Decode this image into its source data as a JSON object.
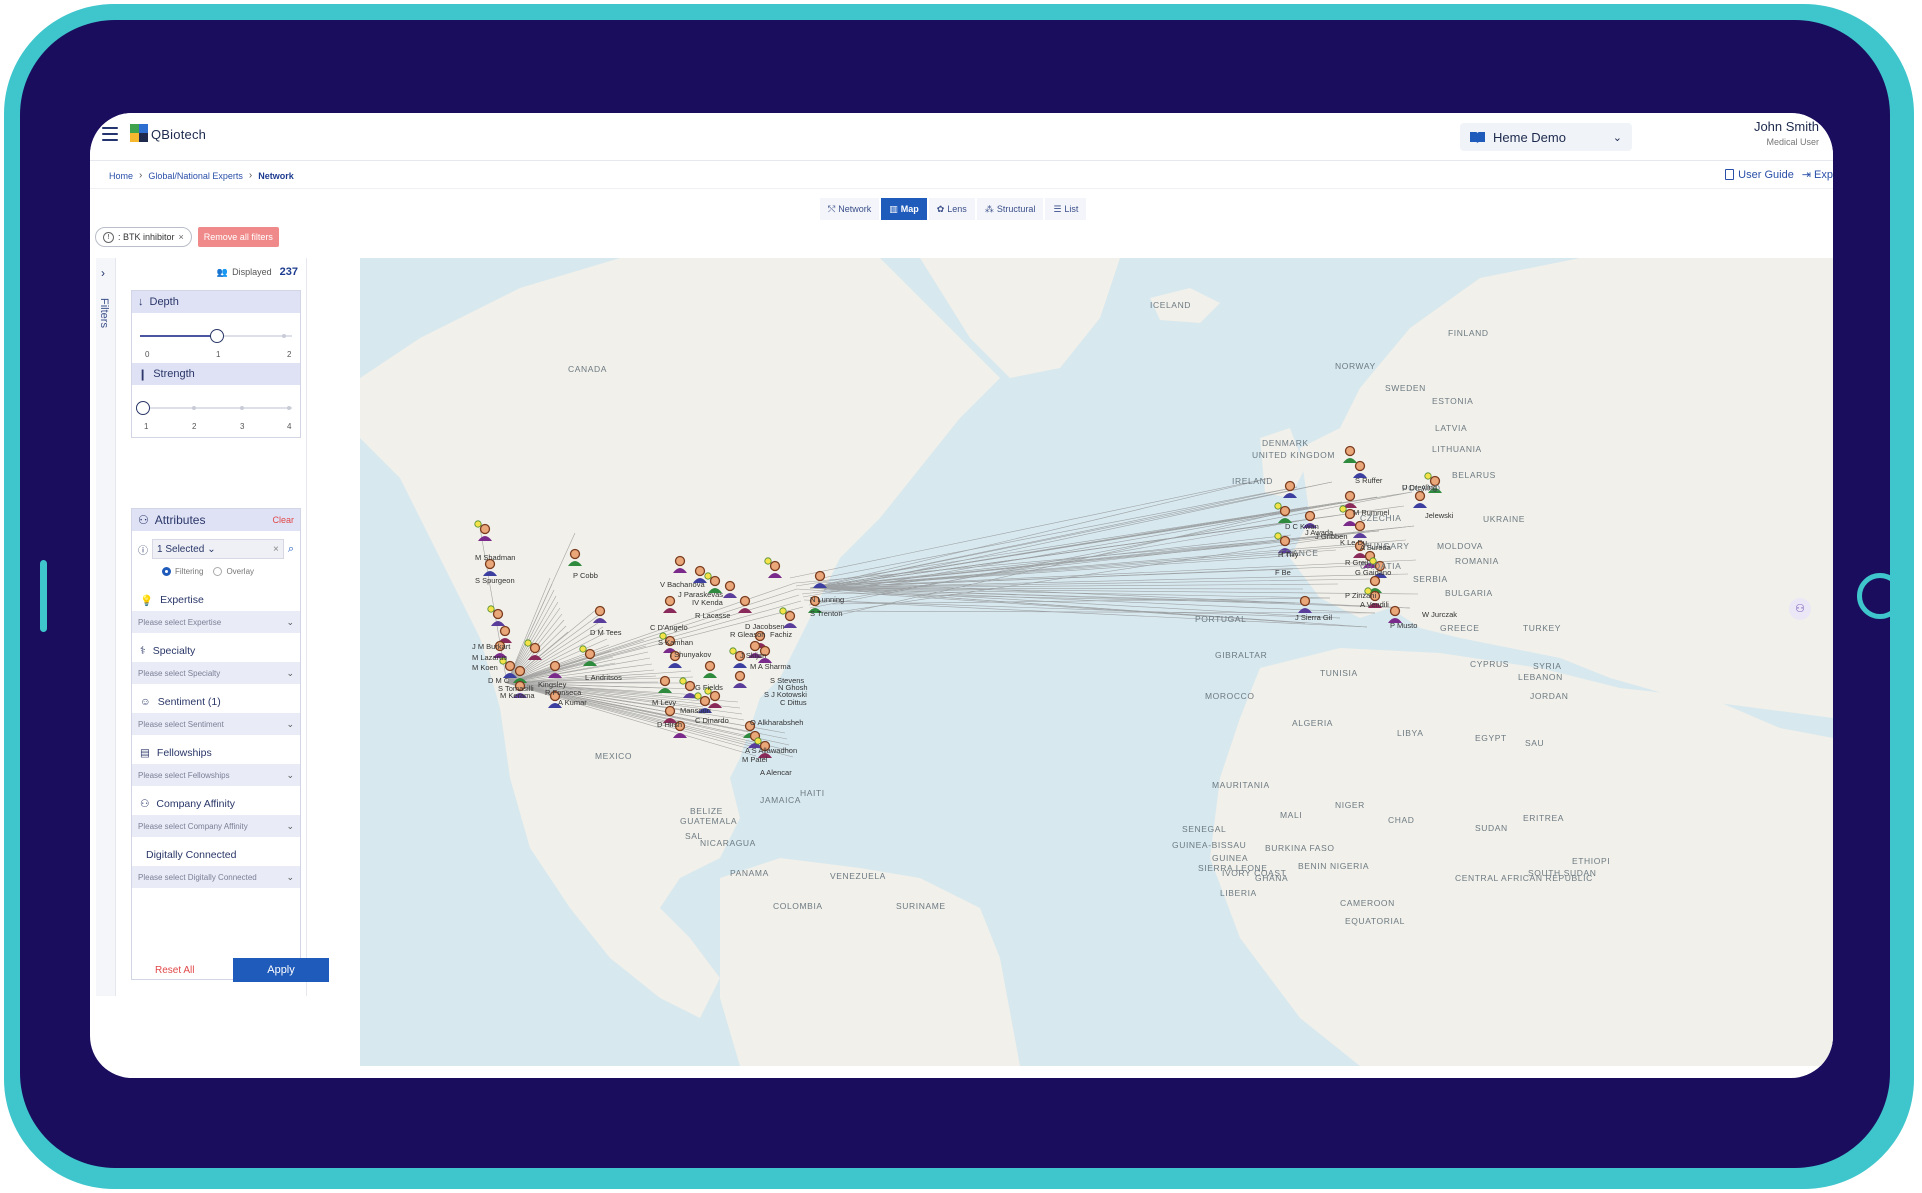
{
  "app": {
    "name": "QBiotech"
  },
  "project": {
    "label": "Heme Demo"
  },
  "user": {
    "name": "John Smith",
    "role": "Medical User"
  },
  "breadcrumb": {
    "items": [
      "Home",
      "Global/National Experts"
    ],
    "current": "Network"
  },
  "header_links": {
    "user_guide": "User Guide",
    "export": "Exp"
  },
  "view_tabs": [
    "Network",
    "Map",
    "Lens",
    "Structural",
    "List"
  ],
  "active_view": "Map",
  "active_filters": {
    "chip_label": ": BTK inhibitor",
    "remove_all": "Remove all filters"
  },
  "sidebar": {
    "tab_label": "Filters",
    "displayed_label": "Displayed",
    "displayed_count": "237",
    "depth": {
      "label": "Depth",
      "ticks": [
        "0",
        "1",
        "2"
      ],
      "value": 1
    },
    "strength": {
      "label": "Strength",
      "ticks": [
        "1",
        "2",
        "3",
        "4"
      ],
      "value": 1
    },
    "attributes": {
      "label": "Attributes",
      "clear": "Clear",
      "selected": "1 Selected",
      "mode_filtering": "Filtering",
      "mode_overlay": "Overlay",
      "items": [
        {
          "label": "Expertise",
          "placeholder": "Please select Expertise"
        },
        {
          "label": "Specialty",
          "placeholder": "Please select Specialty"
        },
        {
          "label": "Sentiment (1)",
          "placeholder": "Please select Sentiment"
        },
        {
          "label": "Fellowships",
          "placeholder": "Please select Fellowships"
        },
        {
          "label": "Company Affinity",
          "placeholder": "Please select Company Affinity"
        },
        {
          "label": "Digitally Connected",
          "placeholder": "Please select Digitally Connected"
        }
      ]
    },
    "reset_label": "Reset All",
    "apply_label": "Apply"
  },
  "map": {
    "places": [
      "ICELAND",
      "CANADA",
      "FINLAND",
      "NORWAY",
      "SWEDEN",
      "ESTONIA",
      "LATVIA",
      "DENMARK",
      "LITHUANIA",
      "UNITED KINGDOM",
      "IRELAND",
      "BELARUS",
      "POLAND",
      "CZECHIA",
      "UKRAINE",
      "FRANCE",
      "HUNGARY",
      "MOLDOVA",
      "ROMANIA",
      "CROATIA",
      "SERBIA",
      "BULGARIA",
      "PORTUGAL",
      "GREECE",
      "TURKEY",
      "GIBRALTAR",
      "TUNISIA",
      "CYPRUS",
      "SYRIA",
      "LEBANON",
      "MOROCCO",
      "JORDAN",
      "ALGERIA",
      "LIBYA",
      "EGYPT",
      "SAU",
      "MEXICO",
      "MAURITANIA",
      "MALI",
      "NIGER",
      "CHAD",
      "SUDAN",
      "ERITREA",
      "BELIZE",
      "JAMAICA",
      "HAITI",
      "GUATEMALA",
      "SAL",
      "NICARAGUA",
      "SENEGAL",
      "GUINEA-BISSAU",
      "GUINEA",
      "BURKINA FASO",
      "BENIN",
      "NIGERIA",
      "SIERRA LEONE",
      "IVORY COAST",
      "GHANA",
      "CENTRAL AFRICAN REPUBLIC",
      "SOUTH SUDAN",
      "ETHIOPI",
      "PANAMA",
      "VENEZUELA",
      "COLOMBIA",
      "SURINAME",
      "LIBERIA",
      "CAMEROON",
      "EQUATORIAL"
    ],
    "experts": [
      "M Shadman",
      "S Spurgeon",
      "P Cobb",
      "J M Burkart",
      "M Lazarus",
      "M Koen",
      "D M C",
      "S Tomasilli",
      "M Kerama",
      "Kingsley",
      "R Fonseca",
      "A Kumar",
      "L Andritsos",
      "D M Tees",
      "C D'Angelo",
      "S Kamhan",
      "I Shunyakov",
      "M Levy",
      "Mansouri",
      "D Hirsh",
      "C Dinardo",
      "O Alkharabsheh",
      "A S Allawadhon",
      "M Patel",
      "A Alencar",
      "V Bachanova",
      "J Paraskevas",
      "IV Kenda",
      "R Lacasse",
      "D Jacobsen",
      "N Lunning",
      "S Trenton",
      "Fachiz",
      "R Gleason",
      "J Skijan",
      "M A Sharma",
      "S Stevens",
      "N Ghosh",
      "S J Kotowski",
      "G Fields",
      "C Dittus",
      "H Tilly",
      "D C Kwan",
      "J Awada",
      "M Rummel",
      "J Gribben",
      "S Ruffer",
      "K Le Du",
      "F Be",
      "R Greil",
      "G Gaidano",
      "P Zinzani",
      "A Vendili",
      "J Sierra Gil",
      "P Musto",
      "W Jurczak",
      "Jelewski",
      "U Dreyling",
      "A Sureda"
    ]
  }
}
